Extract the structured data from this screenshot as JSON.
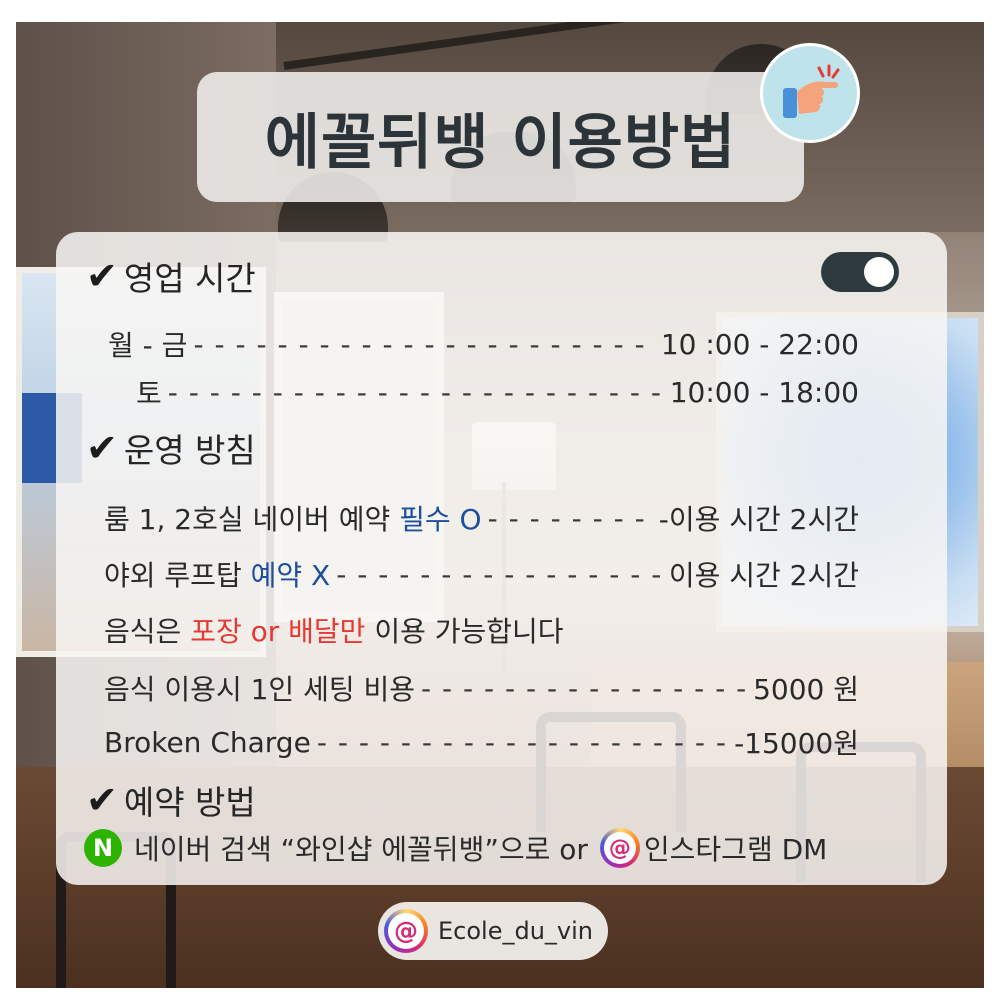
{
  "title": "에꼴뒤뱅 이용방법",
  "colors": {
    "title_text": "#2c3439",
    "accent_blue": "#1d4f9e",
    "accent_red": "#e53935",
    "naver_green": "#2db400",
    "toggle_dark": "#2f3a3f",
    "badge_bg": "#bfe3ea"
  },
  "icons": {
    "badge": "pointing-hand-icon",
    "check": "check-icon",
    "naver": "naver-icon",
    "instagram": "instagram-icon"
  },
  "hours": {
    "heading": "영업 시간",
    "check": "✔",
    "toggle_on": true,
    "rows": [
      {
        "day": "월 - 금",
        "leader": "- - - - - - - - - - - - - - - - - - - - - - - - - - - - - - - - - - - - - - - - - - - - - -",
        "time": "10 :00 - 22:00"
      },
      {
        "day": "토",
        "leader": "- - - - - - - - - - - - - - - - - - - - - - - - - - - - - - - - - - - - - - - - - - - - - -",
        "time": "10:00 - 18:00"
      }
    ]
  },
  "policy": {
    "heading": "운영 방침",
    "check": "✔",
    "room": {
      "prefix": "룸 1, 2호실 네이버 예약 ",
      "highlight": "필수 O",
      "leader": "- - - - - - - - - - - - - - - - - - - - - - - - - - - - - -",
      "right": "-이용 시간 2시간"
    },
    "rooftop": {
      "prefix": "야외 루프탑 ",
      "highlight": "예약 X",
      "leader": "- - - - - - - - - - - - - - - - - - - - - - - - - - - - - - - - - - - - - -",
      "right": "이용 시간 2시간"
    },
    "food": {
      "prefix": "음식은 ",
      "highlight": "포장 or 배달만",
      "suffix": " 이용 가능합니다"
    },
    "setting": {
      "left": "음식 이용시 1인 세팅 비용",
      "leader": "- - - - - - - - - - - - - - - - - - - - - - - - - - - - - - - - - - - - - - - - -",
      "right": "5000 원"
    },
    "broken": {
      "left": "Broken Charge",
      "leader": "- - - - - - - - - - - - - - - - - - - - - - - - - - - - - - - - - - - - - - - - - - - - - - - - - -",
      "right": "-15000원"
    }
  },
  "reserve": {
    "heading": "예약 방법",
    "check": "✔",
    "naver_letter": "N",
    "text": "네이버 검색 “와인샵 에꼴뒤뱅”으로 or ",
    "insta_glyph": "@",
    "dm_text": "인스타그램 DM"
  },
  "instagram_pill": {
    "glyph": "@",
    "handle": "Ecole_du_vin"
  }
}
